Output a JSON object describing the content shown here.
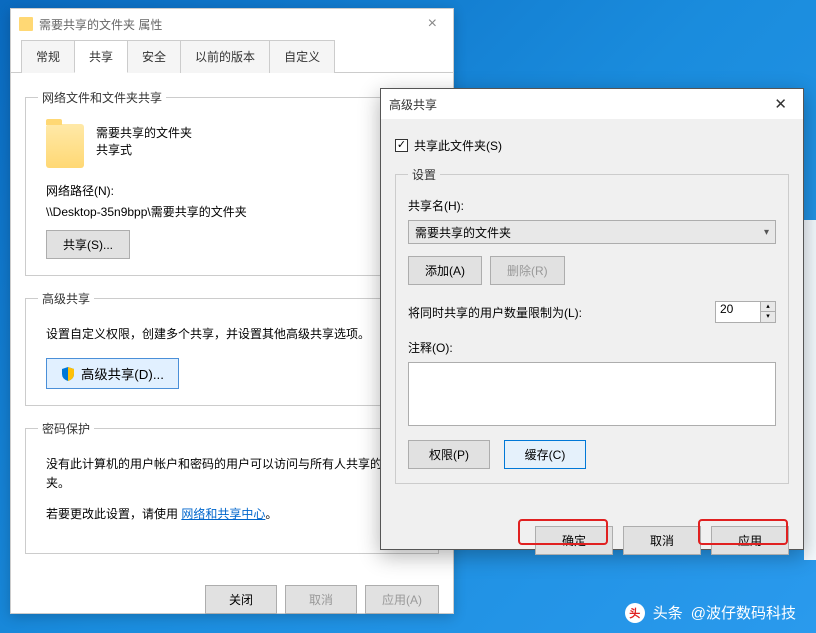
{
  "props": {
    "title": "需要共享的文件夹 属性",
    "tabs": [
      "常规",
      "共享",
      "安全",
      "以前的版本",
      "自定义"
    ],
    "active_tab": 1,
    "netshare": {
      "legend": "网络文件和文件夹共享",
      "folder_name": "需要共享的文件夹",
      "share_state": "共享式",
      "path_label": "网络路径(N):",
      "path_value": "\\\\Desktop-35n9bpp\\需要共享的文件夹",
      "share_button": "共享(S)..."
    },
    "advshare": {
      "legend": "高级共享",
      "desc": "设置自定义权限，创建多个共享，并设置其他高级共享选项。",
      "button": "高级共享(D)..."
    },
    "password": {
      "legend": "密码保护",
      "desc": "没有此计算机的用户帐户和密码的用户可以访问与所有人共享的文件夹。",
      "change_prefix": "若要更改此设置，请使用",
      "link": "网络和共享中心",
      "suffix": "。"
    },
    "footer": {
      "close": "关闭",
      "cancel": "取消",
      "apply": "应用(A)"
    }
  },
  "adv": {
    "title": "高级共享",
    "checkbox_label": "共享此文件夹(S)",
    "settings_legend": "设置",
    "share_name_label": "共享名(H):",
    "share_name_value": "需要共享的文件夹",
    "add_button": "添加(A)",
    "remove_button": "删除(R)",
    "limit_label": "将同时共享的用户数量限制为(L):",
    "limit_value": "20",
    "comment_label": "注释(O):",
    "perm_button": "权限(P)",
    "cache_button": "缓存(C)",
    "ok": "确定",
    "cancel": "取消",
    "apply": "应用"
  },
  "watermark": {
    "prefix": "头条",
    "name": "@波仔数码科技"
  }
}
